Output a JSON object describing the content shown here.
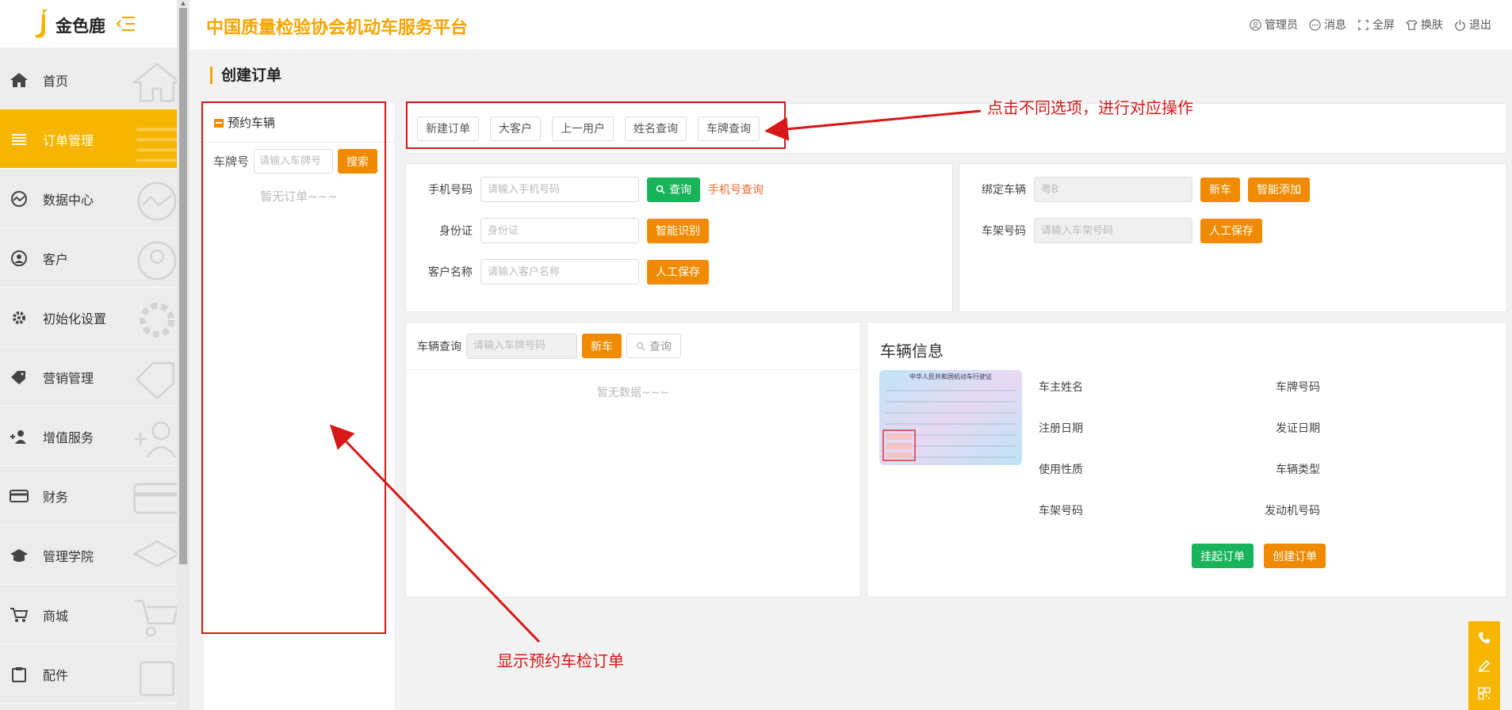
{
  "brand": {
    "name": "金色鹿"
  },
  "header": {
    "platform_title": "中国质量检验协会机动车服务平台",
    "actions": {
      "admin": "管理员",
      "messages": "消息",
      "fullscreen": "全屏",
      "skin": "换肤",
      "logout": "退出"
    }
  },
  "sidebar": {
    "items": [
      {
        "label": "首页",
        "icon": "home-icon",
        "active": false
      },
      {
        "label": "订单管理",
        "icon": "list-icon",
        "active": true
      },
      {
        "label": "数据中心",
        "icon": "chart-icon",
        "active": false
      },
      {
        "label": "客户",
        "icon": "user-icon",
        "active": false
      },
      {
        "label": "初始化设置",
        "icon": "gear-icon",
        "active": false
      },
      {
        "label": "营销管理",
        "icon": "tag-icon",
        "active": false
      },
      {
        "label": "增值服务",
        "icon": "user-add-icon",
        "active": false
      },
      {
        "label": "财务",
        "icon": "card-icon",
        "active": false
      },
      {
        "label": "管理学院",
        "icon": "graduation-icon",
        "active": false
      },
      {
        "label": "商城",
        "icon": "cart-icon",
        "active": false
      },
      {
        "label": "配件",
        "icon": "clipboard-icon",
        "active": false
      }
    ]
  },
  "page": {
    "title": "创建订单"
  },
  "appointment_panel": {
    "title": "预约车辆",
    "plate_label": "车牌号",
    "plate_placeholder": "请输入车牌号",
    "search_button": "搜索",
    "empty_text": "暂无订单~~~"
  },
  "tabs": [
    {
      "label": "新建订单"
    },
    {
      "label": "大客户"
    },
    {
      "label": "上一用户"
    },
    {
      "label": "姓名查询"
    },
    {
      "label": "车牌查询"
    }
  ],
  "customer_form": {
    "phone_label": "手机号码",
    "phone_placeholder": "请输入手机号码",
    "query_button": "查询",
    "phone_query_link": "手机号查询",
    "id_label": "身份证",
    "id_placeholder": "身份证",
    "smart_identify_button": "智能识别",
    "name_label": "客户名称",
    "name_placeholder": "请输入客户名称",
    "manual_save_button": "人工保存"
  },
  "bind_form": {
    "bind_label": "绑定车辆",
    "bind_placeholder": "粤B",
    "new_car_button": "新车",
    "smart_add_button": "智能添加",
    "vin_label": "车架号码",
    "vin_placeholder": "请输入车架号码",
    "manual_save_button": "人工保存"
  },
  "vehicle_query": {
    "label": "车辆查询",
    "placeholder": "请输入车牌号码",
    "new_car_button": "新车",
    "query_button": "查询",
    "empty_text": "暂无数据~~~"
  },
  "vehicle_info": {
    "title": "车辆信息",
    "license_header": "中华人民共和国机动车行驶证",
    "fields": {
      "owner": "车主姓名",
      "plate": "车牌号码",
      "reg_date": "注册日期",
      "issue_date": "发证日期",
      "usage": "使用性质",
      "vehicle_type": "车辆类型",
      "vin": "车架号码",
      "engine": "发动机号码"
    },
    "suspend_button": "挂起订单",
    "create_button": "创建订单"
  },
  "annotations": {
    "top": "点击不同选项，进行对应操作",
    "bottom": "显示预约车检订单"
  },
  "colors": {
    "brand_yellow": "#f6b500",
    "orange_button": "#f08a00",
    "green_button": "#17b45a",
    "annotation_red": "#d81818"
  }
}
